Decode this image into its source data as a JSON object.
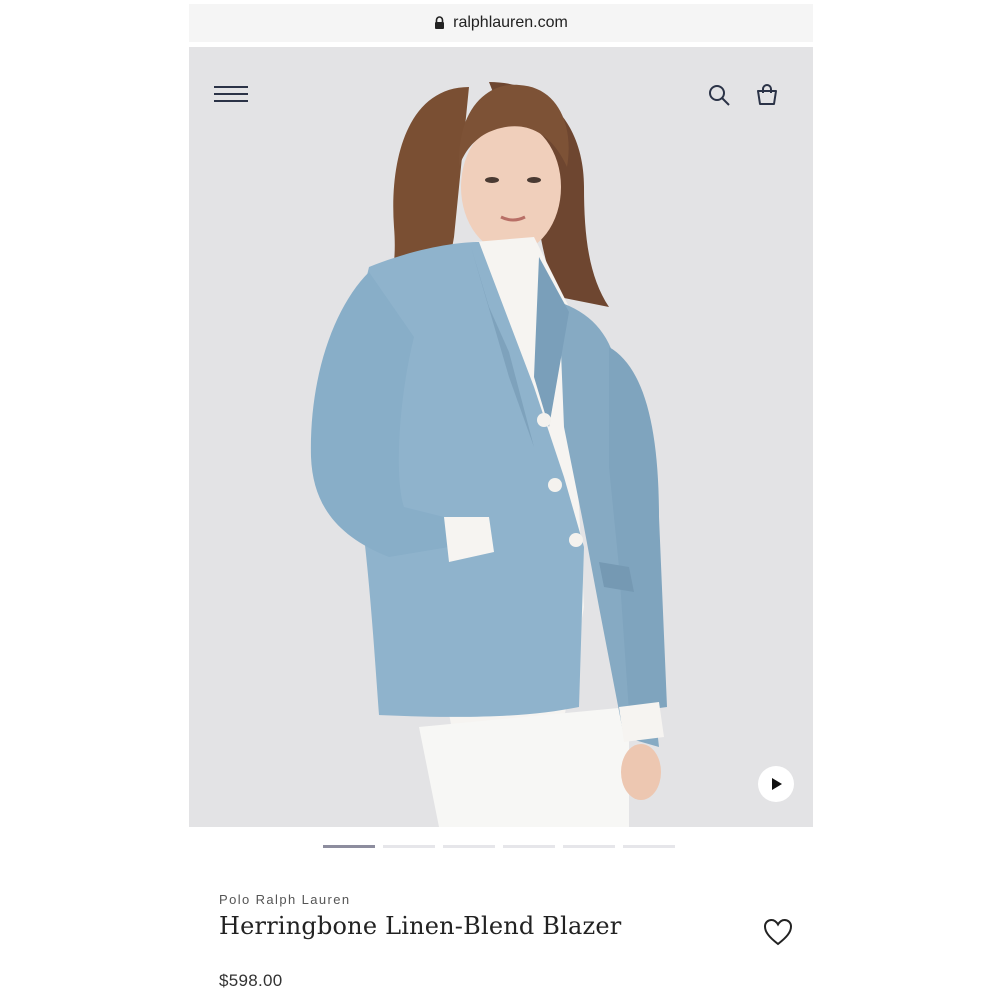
{
  "browser": {
    "url": "ralphlauren.com"
  },
  "icons": {
    "lock": "lock-icon",
    "menu": "hamburger-menu-icon",
    "search": "search-icon",
    "bag": "shopping-bag-icon",
    "play": "play-icon",
    "wishlist": "heart-icon"
  },
  "gallery": {
    "slide_count": 6,
    "active_index": 0
  },
  "product": {
    "brand": "Polo Ralph Lauren",
    "title": "Herringbone Linen-Blend Blazer",
    "price": "$598.00"
  },
  "colors": {
    "hero_background": "#e3e3e5",
    "blazer": "#8fb3cc",
    "active_indicator": "#8d8d9e",
    "inactive_indicator": "#e6e6ea",
    "icon": "#2b3347"
  }
}
